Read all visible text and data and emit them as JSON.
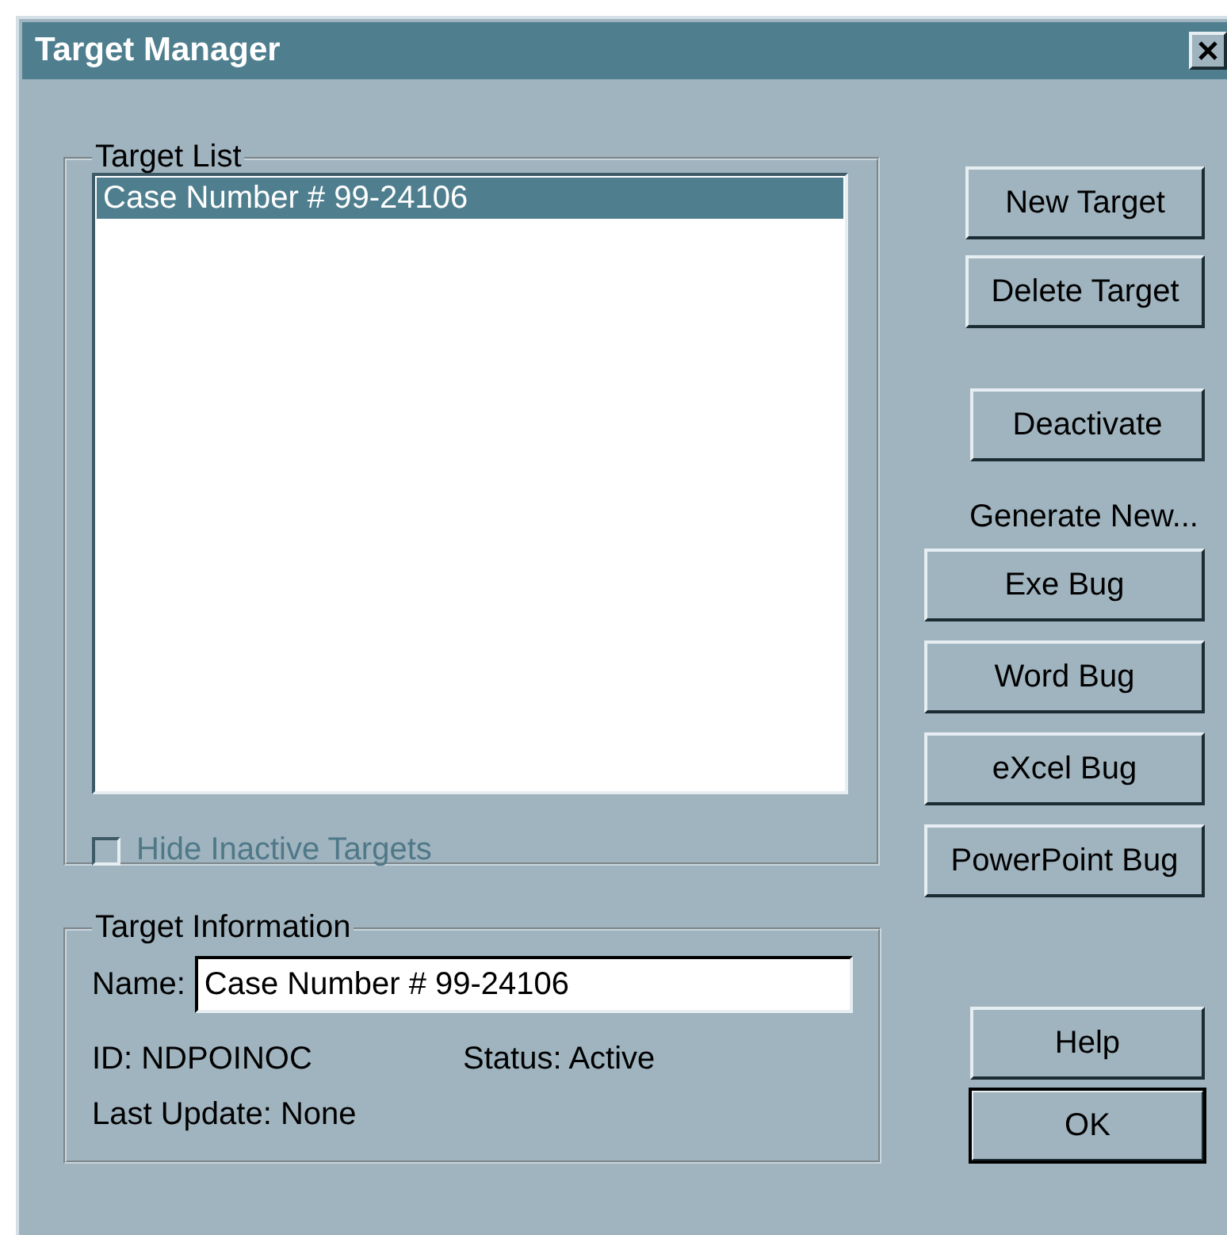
{
  "window": {
    "title": "Target Manager"
  },
  "target_list": {
    "legend": "Target List",
    "items": [
      {
        "label": "Case Number # 99-24106",
        "selected": true
      }
    ],
    "hide_inactive": {
      "label": "Hide Inactive Targets",
      "checked": false,
      "disabled": true
    }
  },
  "target_info": {
    "legend": "Target Information",
    "name_label": "Name:",
    "name_value": "Case Number # 99-24106",
    "id": "ID: NDPOINOC",
    "status": "Status: Active",
    "last_update": "Last Update: None"
  },
  "target_buttons": [
    {
      "label": "New Target"
    },
    {
      "label": "Delete Target"
    }
  ],
  "deactivate": {
    "label": "Deactivate"
  },
  "generate": {
    "caption": "Generate New...",
    "buttons": [
      {
        "label": "Exe Bug"
      },
      {
        "label": "Word Bug"
      },
      {
        "label": "eXcel Bug"
      },
      {
        "label": "PowerPoint Bug"
      }
    ]
  },
  "dialog_buttons": [
    {
      "label": "Help",
      "default": false
    },
    {
      "label": "OK",
      "default": true
    }
  ]
}
